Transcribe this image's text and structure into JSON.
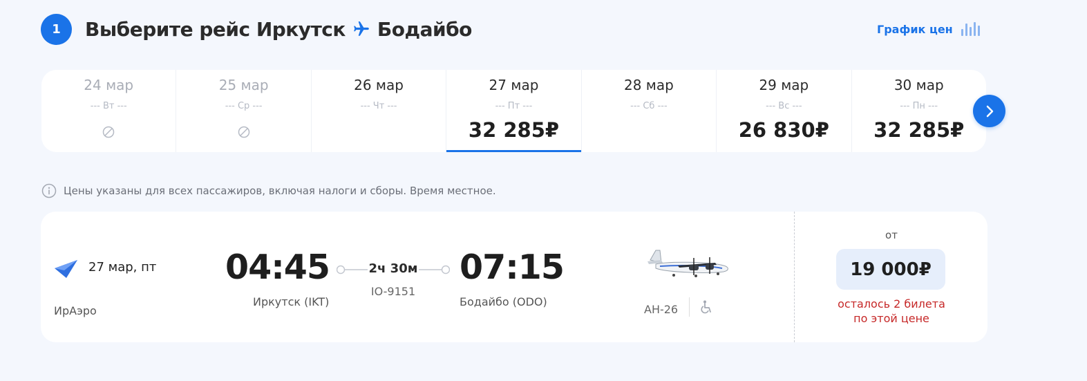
{
  "header": {
    "step_number": "1",
    "title_prefix": "Выберите рейс Иркутск",
    "title_destination": "Бодайбо",
    "price_chart_label": "График цен"
  },
  "dates": [
    {
      "date": "24 мар",
      "weekday": "--- Вт ---",
      "price": "",
      "unavailable": true
    },
    {
      "date": "25 мар",
      "weekday": "--- Ср ---",
      "price": "",
      "unavailable": true
    },
    {
      "date": "26 мар",
      "weekday": "--- Чт ---",
      "price": "",
      "unavailable": false
    },
    {
      "date": "27 мар",
      "weekday": "--- Пт ---",
      "price": "32 285₽",
      "unavailable": false,
      "selected": true
    },
    {
      "date": "28 мар",
      "weekday": "--- Сб ---",
      "price": "",
      "unavailable": false
    },
    {
      "date": "29 мар",
      "weekday": "--- Вс ---",
      "price": "26 830₽",
      "unavailable": false
    },
    {
      "date": "30 мар",
      "weekday": "--- Пн ---",
      "price": "32 285₽",
      "unavailable": false
    }
  ],
  "info_text": "Цены указаны для всех пассажиров, включая налоги и сборы. Время местное.",
  "flight": {
    "date": "27 мар, пт",
    "airline": "ИрАэро",
    "departure_time": "04:45",
    "departure_city": "Иркутск (IKT)",
    "duration": "2ч 30м",
    "flight_number": "IO-9151",
    "arrival_time": "07:15",
    "arrival_city": "Бодайбо (ODO)",
    "aircraft": "АН-26",
    "from_label": "от",
    "price": "19 000₽",
    "seats_left_line1": "осталось 2 билета",
    "seats_left_line2": "по этой цене"
  },
  "colors": {
    "accent": "#1a73e8",
    "background": "#f4f7fd",
    "warning": "#c62828"
  }
}
